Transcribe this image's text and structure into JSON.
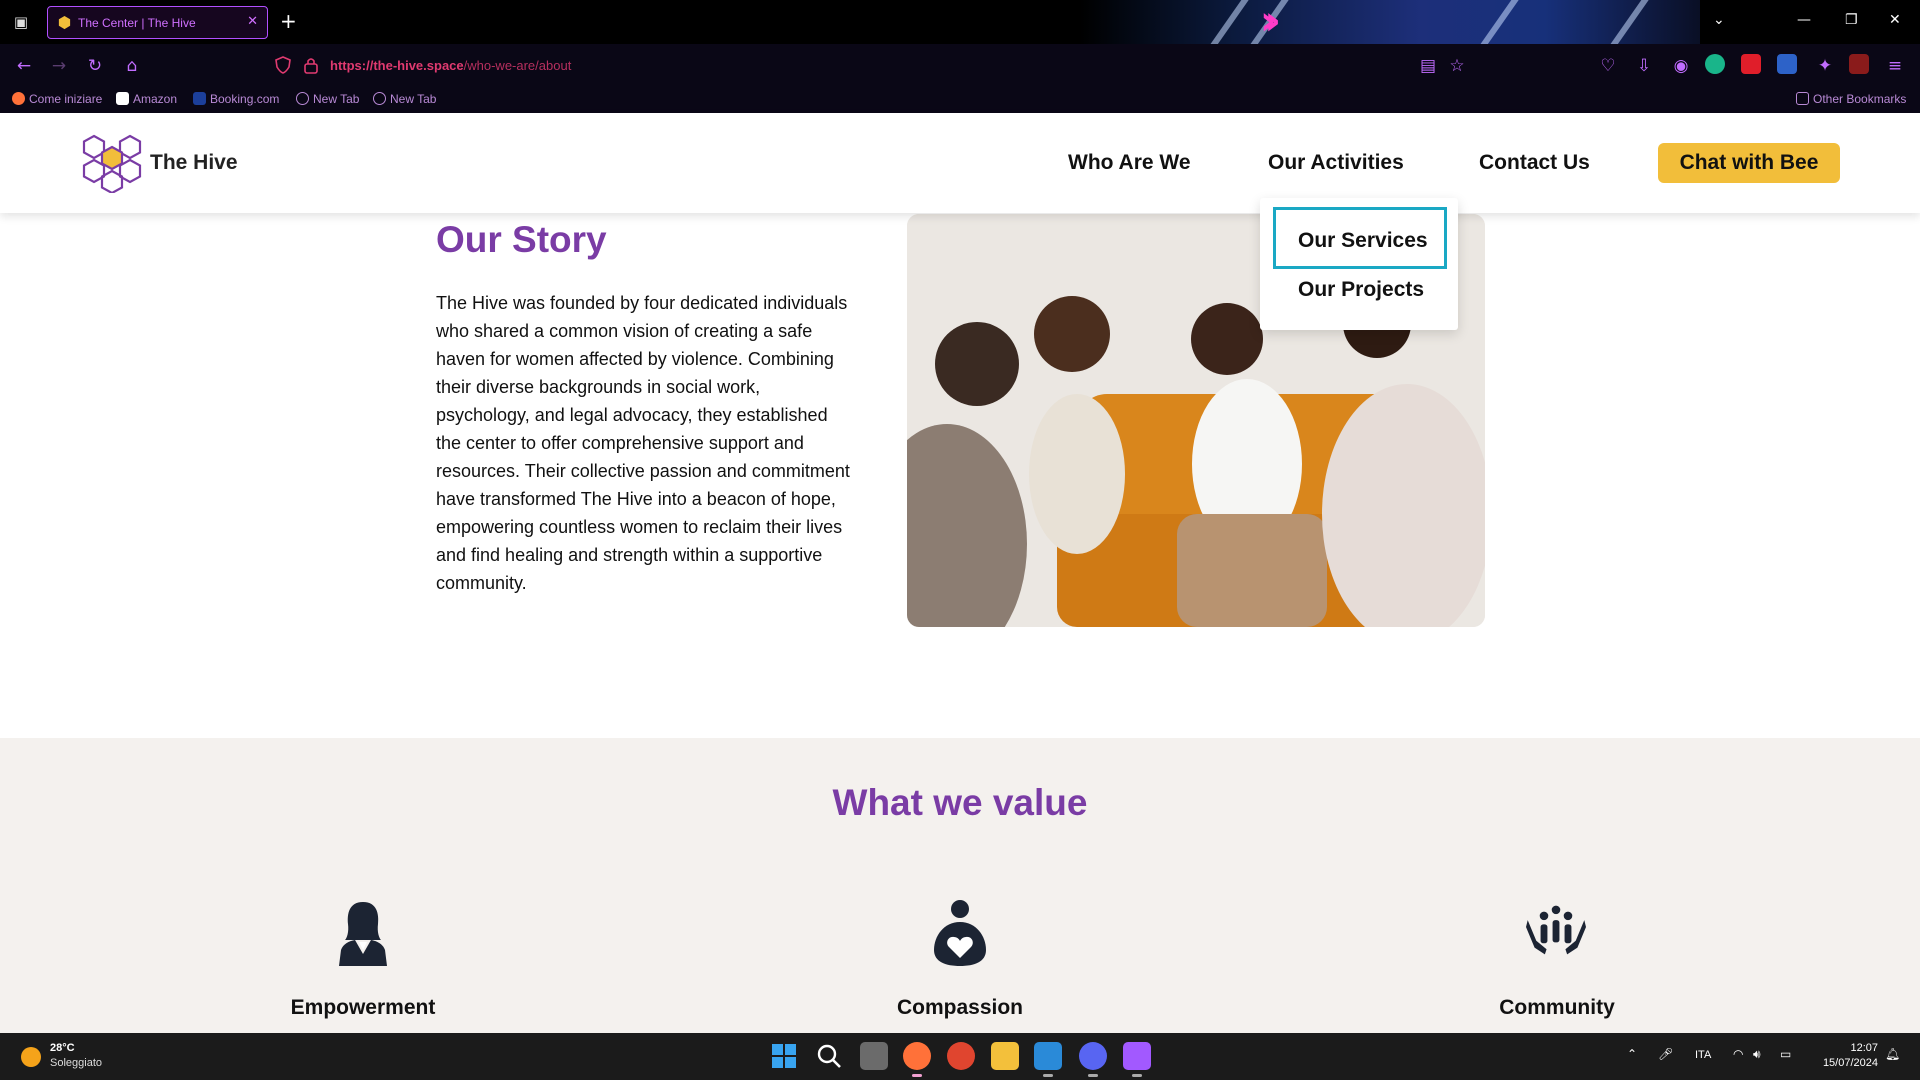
{
  "browser": {
    "tab_title": "The Center | The Hive",
    "url_host": "https://the-hive.space",
    "url_path": "/who-we-are/about",
    "bookmarks": [
      {
        "label": "Come iniziare"
      },
      {
        "label": "Amazon"
      },
      {
        "label": "Booking.com"
      },
      {
        "label": "New Tab"
      },
      {
        "label": "New Tab"
      }
    ],
    "other_bookmarks": "Other Bookmarks"
  },
  "site": {
    "brand": "The Hive",
    "menu": {
      "who_are_we": "Who Are We",
      "our_activities": "Our Activities",
      "contact_us": "Contact Us",
      "cta": "Chat with Bee"
    },
    "dropdown": {
      "services": "Our Services",
      "projects": "Our Projects"
    },
    "story": {
      "title": "Our Story",
      "body": "The Hive was founded by four dedicated individuals who shared a common vision of creating a safe haven for women affected by violence. Combining their diverse backgrounds in social work, psychology, and legal advocacy, they established the center to offer comprehensive support and resources. Their collective passion and commitment have transformed The Hive into a beacon of hope, empowering countless women to reclaim their lives and find healing and strength within a supportive community."
    },
    "values": {
      "title": "What we value",
      "items": [
        {
          "label": "Empowerment",
          "icon": "woman-professional-icon"
        },
        {
          "label": "Compassion",
          "icon": "person-heart-icon"
        },
        {
          "label": "Community",
          "icon": "group-hands-icon"
        }
      ]
    },
    "colors": {
      "accent_purple": "#7a3ca5",
      "cta_yellow": "#f2be3a",
      "focus_outline": "#1aa8c4"
    }
  },
  "taskbar": {
    "temperature": "28°C",
    "weather": "Soleggiato",
    "language": "ITA",
    "time": "12:07",
    "date": "15/07/2024"
  }
}
